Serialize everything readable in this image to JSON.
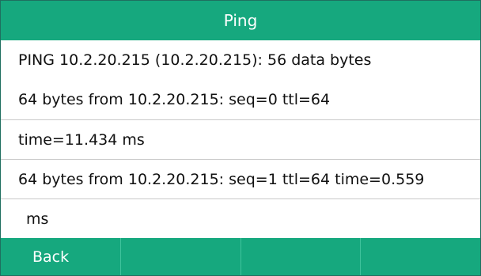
{
  "title": "Ping",
  "lines": [
    "PING 10.2.20.215 (10.2.20.215): 56 data bytes",
    "64 bytes from 10.2.20.215: seq=0 ttl=64",
    "time=11.434 ms",
    "64 bytes from 10.2.20.215: seq=1 ttl=64 time=0.559",
    "ms"
  ],
  "softkeys": [
    "Back",
    "",
    "",
    ""
  ],
  "colors": {
    "accent": "#16a87e",
    "divider": "#c9c9c9"
  }
}
